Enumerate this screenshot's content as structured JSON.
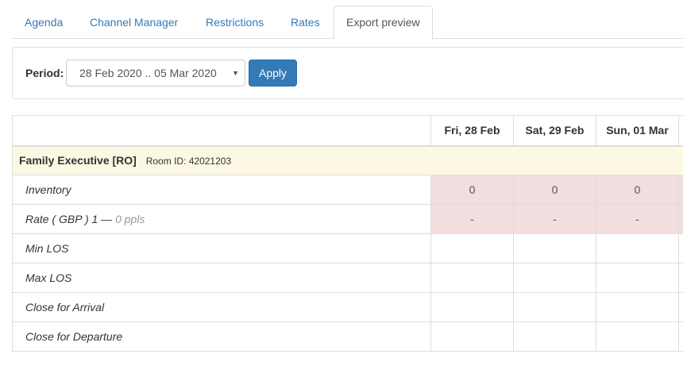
{
  "tabs": [
    {
      "label": "Agenda"
    },
    {
      "label": "Channel Manager"
    },
    {
      "label": "Restrictions"
    },
    {
      "label": "Rates"
    },
    {
      "label": "Export preview",
      "active": true
    }
  ],
  "filter": {
    "period_label": "Period:",
    "period_value": "28 Feb 2020 .. 05 Mar 2020",
    "caret": "▼",
    "apply_label": "Apply"
  },
  "table": {
    "dates": [
      "Fri, 28 Feb",
      "Sat, 29 Feb",
      "Sun, 01 Mar"
    ],
    "room": {
      "name": "Family Executive [RO]",
      "id_text": "Room ID: 42021203"
    },
    "rows": {
      "inventory": {
        "label": "Inventory",
        "values": [
          "0",
          "0",
          "0"
        ]
      },
      "rate": {
        "label": "Rate ( GBP ) 1 —",
        "muted": "0 ppls",
        "values": [
          "-",
          "-",
          "-"
        ]
      },
      "min_los": {
        "label": "Min LOS"
      },
      "max_los": {
        "label": "Max LOS"
      },
      "close_arrival": {
        "label": "Close for Arrival"
      },
      "close_departure": {
        "label": "Close for Departure"
      }
    }
  },
  "colors": {
    "primary": "#337ab7",
    "room_bg": "#fcf8e3",
    "closed_bg": "#f2dede",
    "border": "#dddddd"
  }
}
